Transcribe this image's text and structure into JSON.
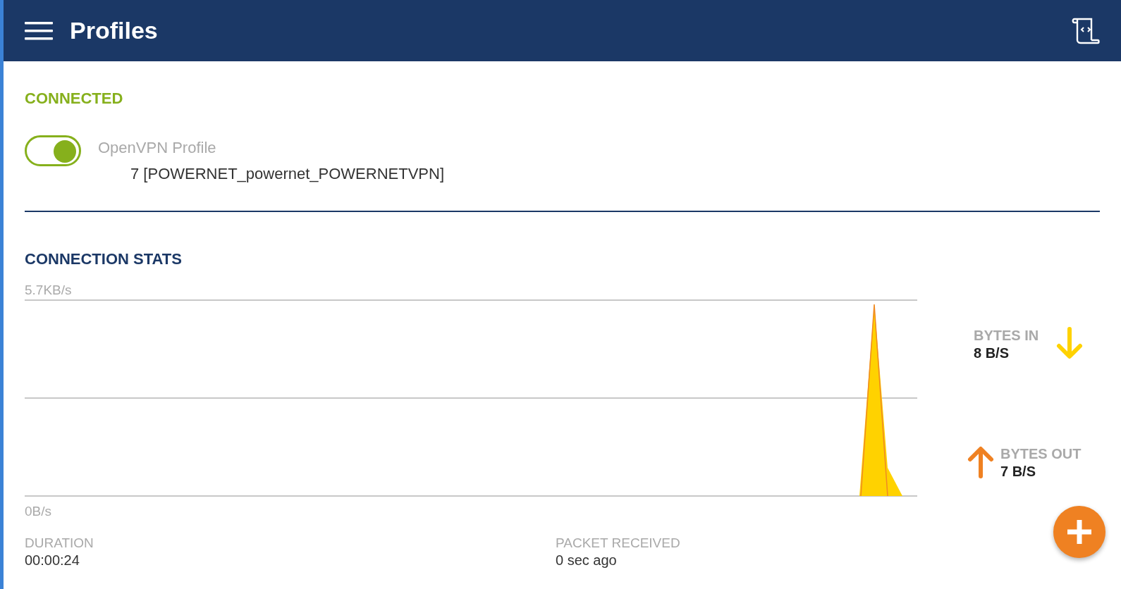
{
  "app_bar": {
    "title": "Profiles"
  },
  "status": {
    "label": "CONNECTED"
  },
  "profile": {
    "type_label": "OpenVPN Profile",
    "name": "7 [POWERNET_powernet_POWERNETVPN]",
    "on": true
  },
  "stats": {
    "title": "CONNECTION STATS",
    "graph": {
      "max_label": "5.7KB/s",
      "min_label": "0B/s"
    },
    "bytes_in": {
      "label": "BYTES IN",
      "value": "8 B/S"
    },
    "bytes_out": {
      "label": "BYTES OUT",
      "value": "7 B/S"
    },
    "details": [
      {
        "label": "DURATION",
        "value": "00:00:24"
      },
      {
        "label": "PACKET RECEIVED",
        "value": "0 sec ago"
      }
    ]
  }
}
